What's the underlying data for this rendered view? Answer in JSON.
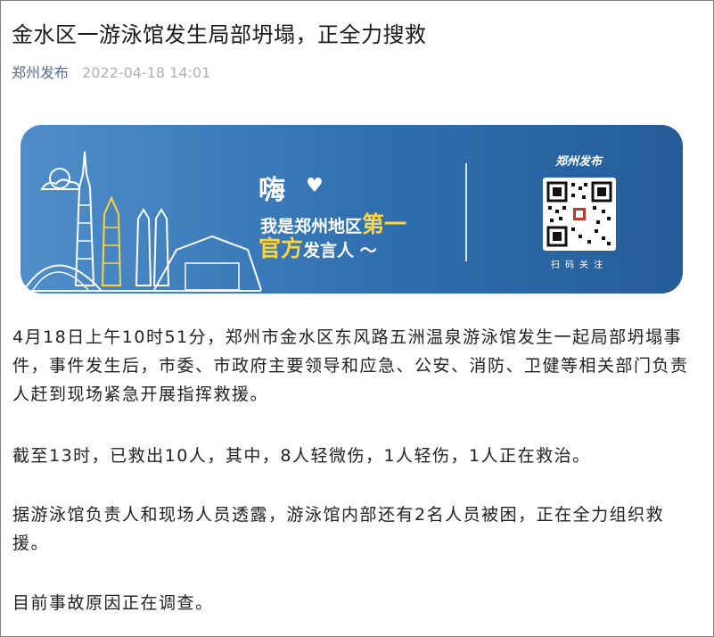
{
  "article": {
    "title": "金水区一游泳馆发生局部坍塌，正全力搜救",
    "author": "郑州发布",
    "date": "2022-04-18 14:01"
  },
  "banner": {
    "greeting": "嗨",
    "heart_icon": "heart-icon",
    "line1_prefix": "我是郑州地区",
    "line1_highlight": "第一",
    "line2_highlight": "官方",
    "line2_suffix": "发言人",
    "qr_logo": "郑州发布",
    "qr_label": "扫码关注",
    "colors": {
      "bg": "#2f6faf",
      "highlight": "#ffd43b"
    }
  },
  "paragraphs": [
    "4月18日上午10时51分，郑州市金水区东风路五洲温泉游泳馆发生一起局部坍塌事件，事件发生后，市委、市政府主要领导和应急、公安、消防、卫健等相关部门负责人赶到现场紧急开展指挥救援。",
    "截至13时，已救出10人，其中，8人轻微伤，1人轻伤，1人正在救治。",
    "据游泳馆负责人和现场人员透露，游泳馆内部还有2名人员被困，正在全力组织救援。",
    "目前事故原因正在调查。"
  ]
}
